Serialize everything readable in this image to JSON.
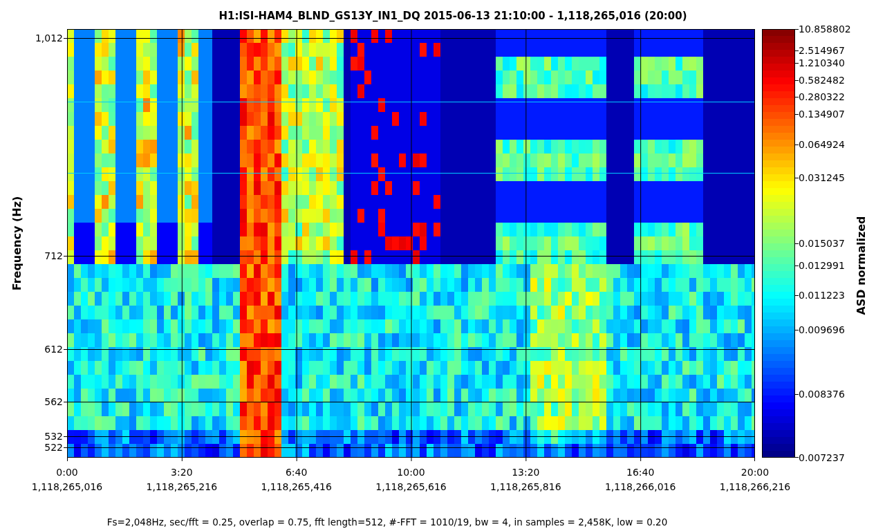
{
  "title": "H1:ISI-HAM4_BLND_GS13Y_IN1_DQ 2015-06-13 21:10:00 - 1,118,265,016 (20:00)",
  "plot": {
    "ylabel": "Frequency (Hz)",
    "yticks": [
      "1,012",
      "712",
      "612",
      "562",
      "532",
      "522"
    ],
    "xticks": [
      {
        "time": "0:00",
        "gps": "1,118,265,016"
      },
      {
        "time": "3:20",
        "gps": "1,118,265,216"
      },
      {
        "time": "6:40",
        "gps": "1,118,265,416"
      },
      {
        "time": "10:00",
        "gps": "1,118,265,616"
      },
      {
        "time": "13:20",
        "gps": "1,118,265,816"
      },
      {
        "time": "16:40",
        "gps": "1,118,266,016"
      },
      {
        "time": "20:00",
        "gps": "1,118,266,216"
      }
    ]
  },
  "colorbar": {
    "label": "ASD normalized",
    "ticks": [
      "10.858802",
      "2.514967",
      "1.210340",
      "0.582482",
      "0.280322",
      "0.134907",
      "0.064924",
      "0.031245",
      "0.015037",
      "0.012991",
      "0.011223",
      "0.009696",
      "0.008376",
      "0.007237"
    ]
  },
  "caption": "Fs=2,048Hz, sec/fft = 0.25, overlap = 0.75, fft length=512, #-FFT = 1010/19, bw = 4, in samples = 2,458K, low = 0.20"
}
